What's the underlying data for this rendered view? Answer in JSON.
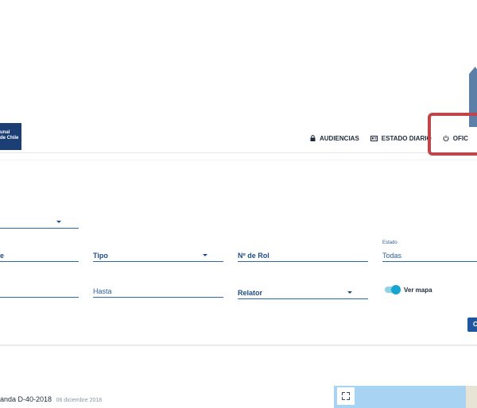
{
  "header": {
    "logo_line1": "unal",
    "logo_line2": "de Chile",
    "nav": [
      {
        "label": "AUDIENCIAS",
        "icon": "lock-icon"
      },
      {
        "label": "ESTADO DIARIO",
        "icon": "id-card-icon"
      },
      {
        "label": "OFIC",
        "icon": "power-icon"
      }
    ]
  },
  "filters": {
    "row1_label": "e",
    "tipo_label": "Tipo",
    "rol_label": "Nº de Rol",
    "estado_caption": "Estado",
    "estado_value": "Todas",
    "hasta_placeholder": "Hasta",
    "relator_label": "Relator",
    "toggle_label": "Ver mapa",
    "search_label": "C"
  },
  "results": {
    "item_title": "anda D-40-2018",
    "item_date": "06 diciembre 2018"
  },
  "colors": {
    "brand": "#1b3f75",
    "accent": "#17a6d1",
    "callout": "#c0454a"
  }
}
